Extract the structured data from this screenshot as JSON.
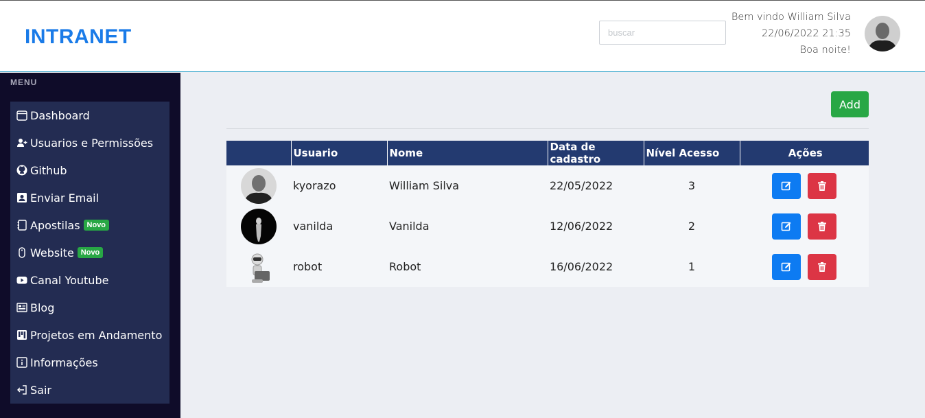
{
  "header": {
    "brand": "INTRANET",
    "search_placeholder": "buscar",
    "welcome": "Bem vindo William Silva",
    "datetime": "22/06/2022 21:35",
    "greeting": "Boa noite!"
  },
  "sidebar": {
    "title": "MENU",
    "items": [
      {
        "label": "Dashboard",
        "icon": "calendar-icon"
      },
      {
        "label": "Usuarios e Permissões",
        "icon": "user-plus-icon"
      },
      {
        "label": "Github",
        "icon": "github-icon"
      },
      {
        "label": "Enviar Email",
        "icon": "contact-card-icon"
      },
      {
        "label": "Apostilas",
        "icon": "notebook-icon",
        "badge": "Novo"
      },
      {
        "label": "Website",
        "icon": "mouse-icon",
        "badge": "Novo"
      },
      {
        "label": "Canal Youtube",
        "icon": "youtube-icon"
      },
      {
        "label": "Blog",
        "icon": "newspaper-icon"
      },
      {
        "label": "Projetos em Andamento",
        "icon": "kanban-icon"
      },
      {
        "label": "Informações",
        "icon": "info-icon"
      },
      {
        "label": "Sair",
        "icon": "logout-icon"
      }
    ]
  },
  "main": {
    "add_label": "Add",
    "table": {
      "headers": [
        "",
        "Usuario",
        "Nome",
        "Data de cadastro",
        "Nível Acesso",
        "Ações"
      ],
      "rows": [
        {
          "usuario": "kyorazo",
          "nome": "William Silva",
          "data": "22/05/2022",
          "nivel": "3"
        },
        {
          "usuario": "vanilda",
          "nome": "Vanilda",
          "data": "12/06/2022",
          "nivel": "2"
        },
        {
          "usuario": "robot",
          "nome": "Robot",
          "data": "16/06/2022",
          "nivel": "1"
        }
      ]
    }
  },
  "colors": {
    "brand": "#1a7be8",
    "sidebar_bg": "#0f0c29",
    "menu_bg": "#232c52",
    "table_header": "#233a70",
    "add_button": "#28a745",
    "edit_button": "#0d7bf2",
    "delete_button": "#dc3545"
  }
}
